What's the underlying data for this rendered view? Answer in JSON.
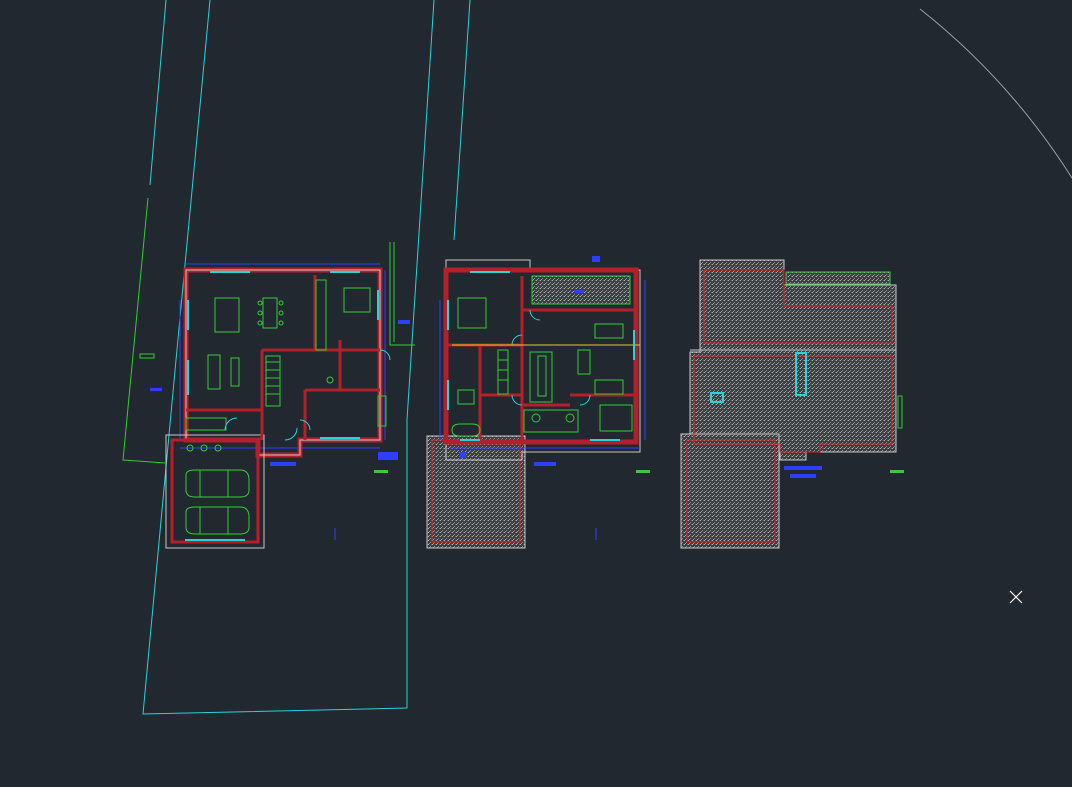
{
  "app": {
    "background_color": "#212830"
  },
  "colors": {
    "property_boundary": "#26d4d9",
    "site_line": "#2fcf2f",
    "walls": "#b51f2a",
    "wall_outline": "#c8c8c8",
    "dimensions": "#2f3fff",
    "furniture": "#2fcf2f",
    "glazing": "#26d4d9",
    "roof_hatch": "#8a8a8a",
    "ridge": "#d92020",
    "highlight": "#e0d020",
    "grey_arc": "#9aa0a6"
  },
  "drawings": [
    {
      "id": "ground-floor-plan"
    },
    {
      "id": "first-floor-plan"
    },
    {
      "id": "roof-plan"
    }
  ],
  "icons": {
    "cursor": "crosshair-x-icon"
  }
}
